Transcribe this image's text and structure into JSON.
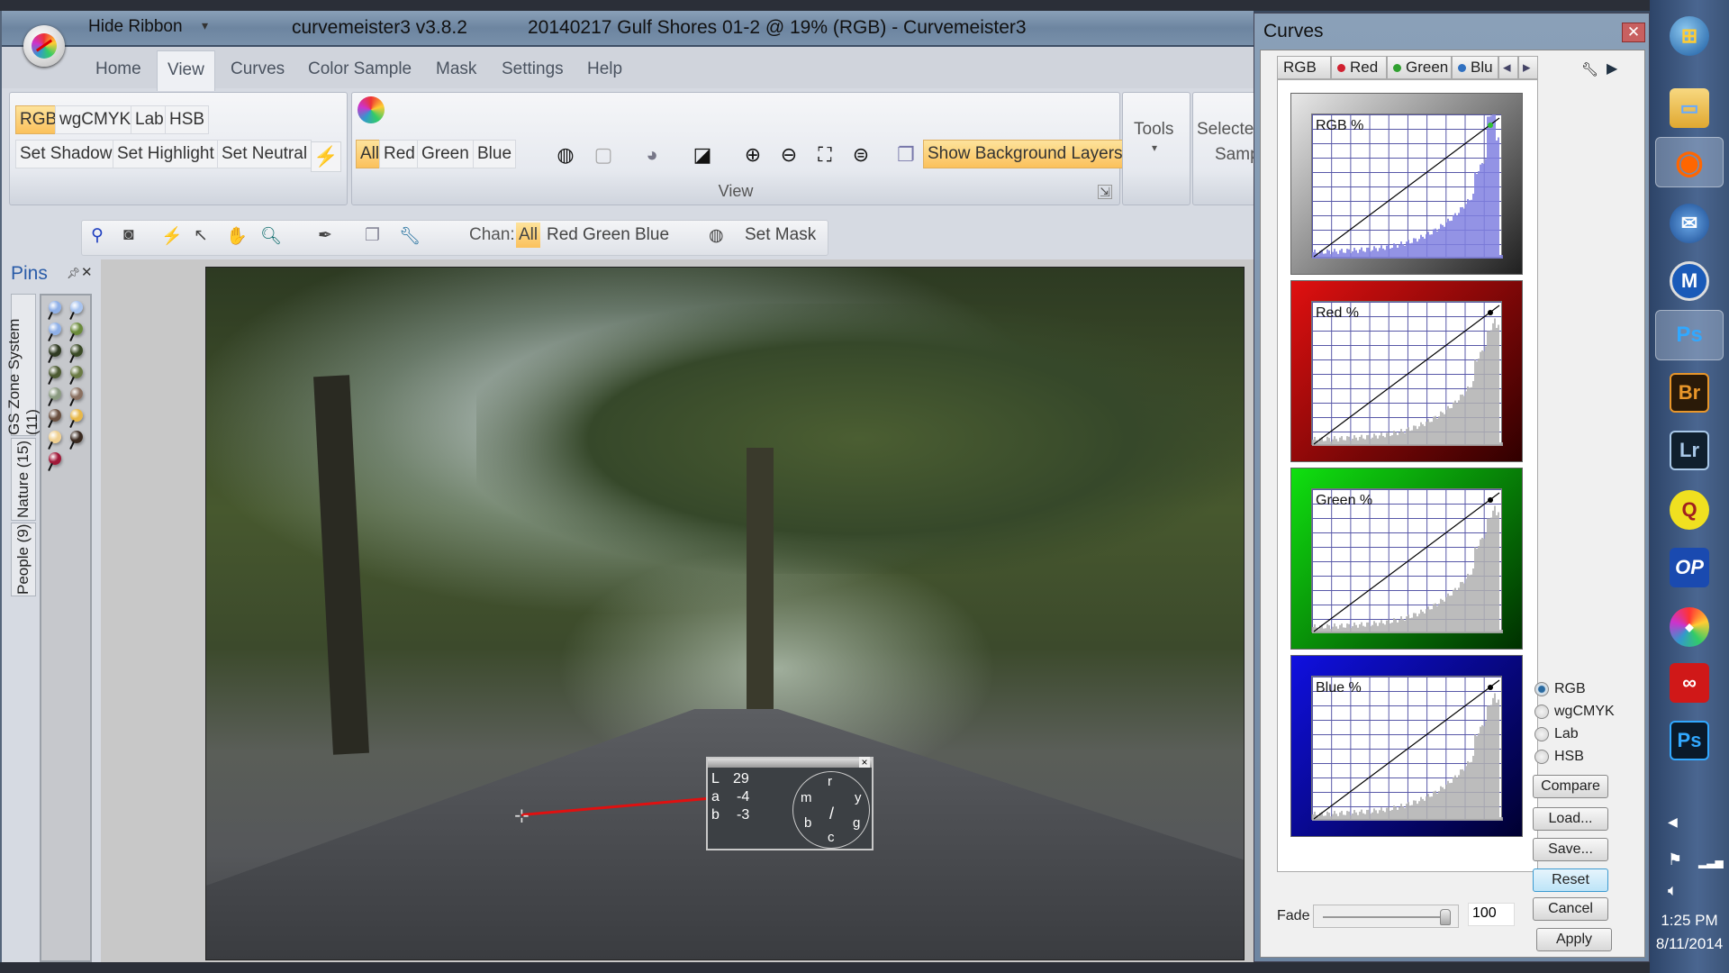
{
  "window": {
    "hide_ribbon": "Hide Ribbon",
    "app_version": "curvemeister3 v3.8.2",
    "doc_title": "20140217 Gulf Shores 01-2 @ 19% (RGB) - Curvemeister3"
  },
  "menu_tabs": [
    "Home",
    "View",
    "Curves",
    "Color Sample",
    "Mask",
    "Settings",
    "Help"
  ],
  "active_tab": "View",
  "ribbon": {
    "color_modes": [
      "RGB",
      "wgCMYK",
      "Lab",
      "HSB"
    ],
    "selected_mode": "RGB",
    "set_buttons": [
      "Set Shadow",
      "Set Highlight",
      "Set Neutral"
    ],
    "view_channels": [
      "All",
      "Red",
      "Green",
      "Blue"
    ],
    "selected_channel": "All",
    "show_bg_layers": "Show Background Layers",
    "view_group_label": "View",
    "tools_label": "Tools",
    "selected_sample_label_1": "Selected",
    "selected_sample_label_2": "Samp"
  },
  "toolbar": {
    "chan_label": "Chan:",
    "channels": [
      "All",
      "Red",
      "Green",
      "Blue"
    ],
    "selected_channel": "All",
    "set_mask": "Set Mask"
  },
  "pins": {
    "title": "Pins",
    "tabs": [
      "GS Zone System (11)",
      "Nature (15)",
      "People (9)"
    ],
    "pin_colors": [
      "#8fb0e8",
      "#a8c4f0",
      "#8fb0e8",
      "#6a8a3a",
      "#2f3a22",
      "#3a4a26",
      "#4c5a32",
      "#6a7a44",
      "#8a9a80",
      "#8a7060",
      "#6a5040",
      "#e8b848",
      "#f0d090",
      "#3a2a20",
      "#a01838"
    ]
  },
  "sampler": {
    "L": "29",
    "a": "-4",
    "b": "-3",
    "L_label": "L",
    "a_label": "a",
    "b_label": "b",
    "dial_labels": {
      "top": "r",
      "left_top": "m",
      "right_top": "y",
      "left_bottom": "b",
      "right_bottom": "g",
      "bottom": "c"
    }
  },
  "curves_dialog": {
    "title": "Curves",
    "tabs": [
      {
        "label": "RGB",
        "color": ""
      },
      {
        "label": "Red",
        "color": "#d02030"
      },
      {
        "label": "Green",
        "color": "#30a030"
      },
      {
        "label": "Blu",
        "color": "#3070c0"
      }
    ],
    "graphs": [
      {
        "label": "RGB %",
        "frame_from": "#e8e8e8",
        "frame_to": "#202020",
        "hist": "#8080e0"
      },
      {
        "label": "Red %",
        "frame_from": "#e01010",
        "frame_to": "#300000",
        "hist": "#b0b0b0"
      },
      {
        "label": "Green %",
        "frame_from": "#10e010",
        "frame_to": "#003000",
        "hist": "#b0b0b0"
      },
      {
        "label": "Blue %",
        "frame_from": "#1010e0",
        "frame_to": "#000030",
        "hist": "#b0b0b0"
      }
    ],
    "modes": [
      "RGB",
      "wgCMYK",
      "Lab",
      "HSB"
    ],
    "selected_mode": "RGB",
    "buttons": {
      "compare": "Compare",
      "load": "Load...",
      "save": "Save...",
      "reset": "Reset",
      "cancel": "Cancel",
      "apply": "Apply"
    },
    "fade_label": "Fade",
    "fade_value": "100",
    "fade_fraction": 1.0
  },
  "taskbar": {
    "icons": [
      "windows-start",
      "file-explorer",
      "firefox",
      "thunderbird",
      "maxthon",
      "photoshop",
      "bridge",
      "lightroom",
      "qimage",
      "op",
      "nikon",
      "creative-cloud",
      "photoshop-2"
    ],
    "time": "1:25 PM",
    "date": "8/11/2014"
  }
}
